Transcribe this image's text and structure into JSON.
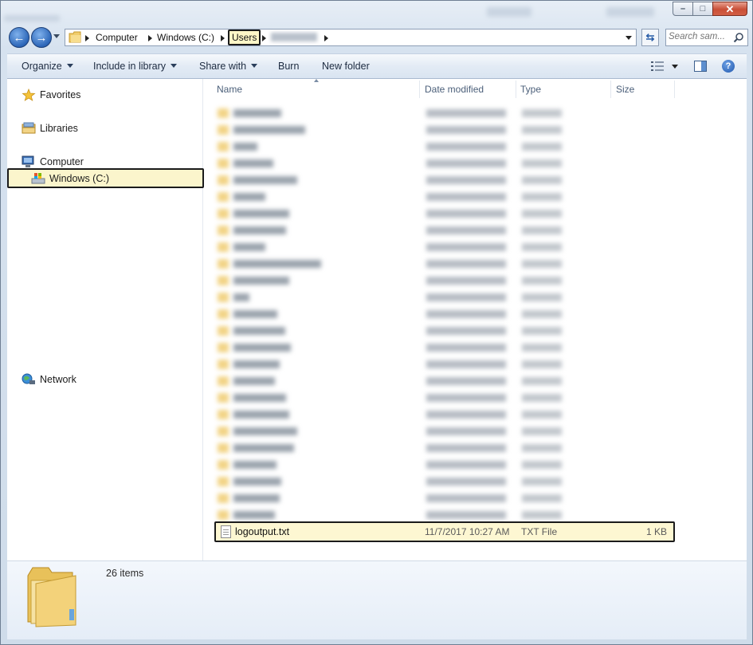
{
  "window": {
    "caption": {
      "minimize": "–",
      "maximize": "□",
      "close": "✕"
    }
  },
  "address_bar": {
    "crumbs": [
      "Computer",
      "Windows (C:)",
      "Users"
    ],
    "highlighted_crumb": "Users"
  },
  "search": {
    "placeholder": "Search sam..."
  },
  "toolbar": {
    "organize": "Organize",
    "include_in_library": "Include in library",
    "share_with": "Share with",
    "burn": "Burn",
    "new_folder": "New folder"
  },
  "nav_pane": {
    "favorites": "Favorites",
    "libraries": "Libraries",
    "computer": "Computer",
    "windows_c": "Windows (C:)",
    "network": "Network"
  },
  "columns": {
    "name": "Name",
    "date_modified": "Date modified",
    "type": "Type",
    "size": "Size"
  },
  "files": [
    {
      "name": "logoutput.txt",
      "date": "11/7/2017 10:27 AM",
      "type": "TXT File",
      "size": "1 KB"
    }
  ],
  "details": {
    "item_count": "26 items"
  },
  "colors": {
    "selection": "#fdf7d2",
    "folder": "#f2d486",
    "accent": "#2c66b8"
  }
}
